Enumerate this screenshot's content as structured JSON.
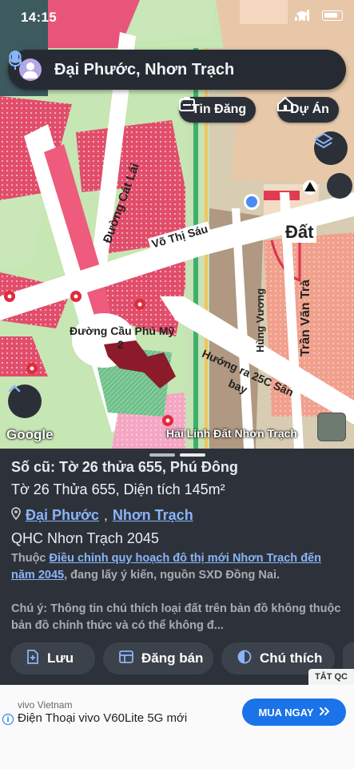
{
  "status_bar": {
    "time": "14:15"
  },
  "search": {
    "query": "Đại Phước, Nhơn Trạch"
  },
  "chips": {
    "tin_dang": "Tin Đăng",
    "du_an": "Dự Án"
  },
  "map": {
    "labels": {
      "duong_cat_lai": "Đường Cát Lái",
      "vo_thi_sau": "Võ Thị Sáu",
      "dat": "Đất",
      "hung_vuong": "Hùng Vương",
      "tran_van_tra": "Trần Văn Trà",
      "cau_phu_my_1": "Đường Cầu Phú Mỹ",
      "cau_phu_my_2": "2",
      "huong_ra_1": "Hướng ra 25C Sân",
      "huong_ra_2": "bay"
    },
    "google_logo": "Google",
    "watermark": "Hải Linh Đất Nhơn Trạch",
    "colors": {
      "residential": "#e2426a",
      "green": "#c9e7b8",
      "road": "#ffffff",
      "brown": "#a88a72",
      "orange": "#f39b8b"
    }
  },
  "panel": {
    "title": "Số cũ: Tờ 26 thửa 655, Phú Đông",
    "subtitle": "Tờ 26 Thửa 655, Diện tích 145m²",
    "location_ward": "Đại Phước",
    "location_sep": ",",
    "location_district": "Nhơn Trạch",
    "qhc": "QHC Nhơn Trạch 2045",
    "note_prefix": "Thuộc ",
    "note_link": "Điều chỉnh quy hoạch đô thị mới Nhơn Trạch đến năm 2045",
    "note_suffix": ", đang lấy ý kiến, nguồn SXD Đồng Nai.",
    "warning": "Chú ý: Thông tin chú thích loại đất trên bản đồ không thuộc bản đồ chính thức và có thể không đ...",
    "actions": [
      {
        "label": "Lưu",
        "icon": "save-icon"
      },
      {
        "label": "Đăng bán",
        "icon": "listing-icon"
      },
      {
        "label": "Chú thích",
        "icon": "legend-icon"
      }
    ]
  },
  "ad": {
    "tag": "TẮT QC",
    "brand": "vivo Vietnam",
    "title": "Điện Thoại vivo V60Lite 5G mới",
    "cta": "MUA NGAY"
  }
}
